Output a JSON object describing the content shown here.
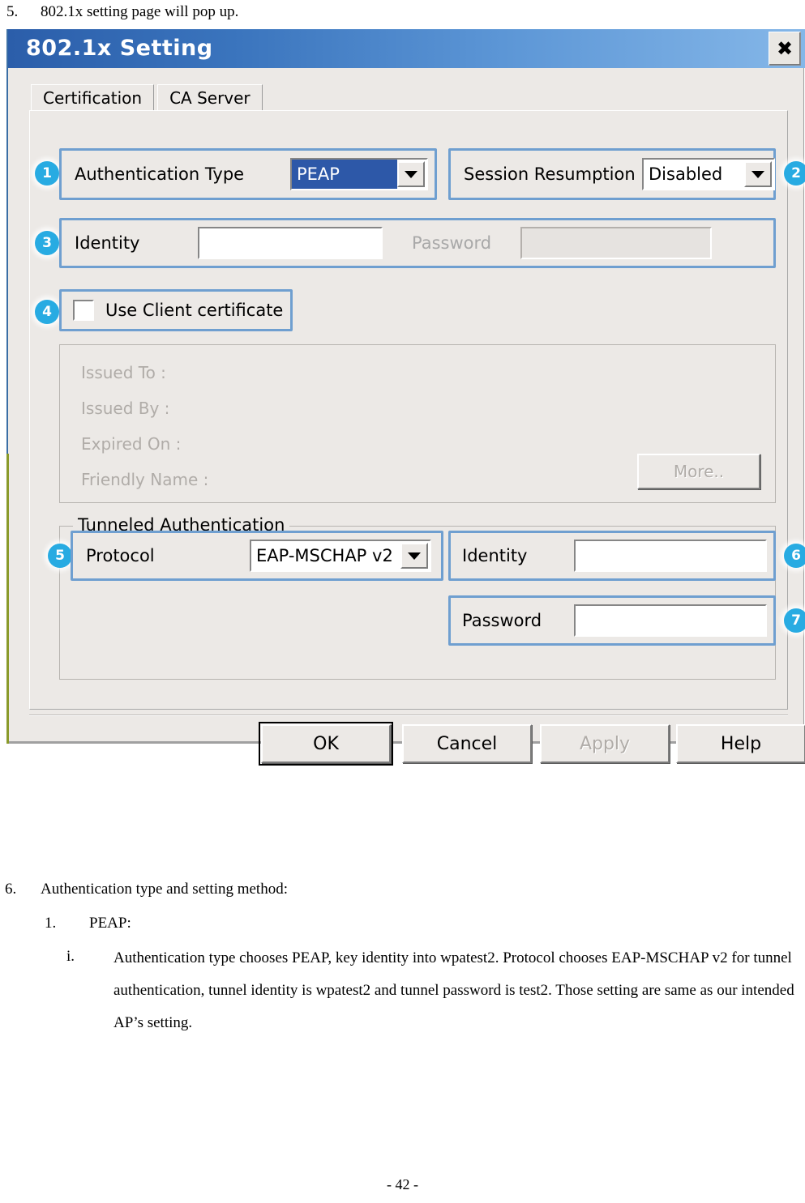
{
  "document": {
    "step5": {
      "number": "5.",
      "text": "802.1x setting page will pop up."
    },
    "step6": {
      "number": "6.",
      "text": "Authentication type and setting method:"
    },
    "sub1": {
      "number": "1.",
      "text": "PEAP:"
    },
    "subi": {
      "number": "i.",
      "text": "Authentication type chooses PEAP, key identity into wpatest2. Protocol chooses EAP-MSCHAP v2 for tunnel authentication, tunnel identity is wpatest2 and tunnel password is test2. Those setting are same as our intended AP’s setting."
    },
    "footer": "- 42 -"
  },
  "dialog": {
    "title": "802.1x Setting",
    "close_label": "✖",
    "tabs": [
      {
        "label": "Certification",
        "active": true
      },
      {
        "label": "CA Server",
        "active": false
      }
    ],
    "auth_type": {
      "label": "Authentication Type",
      "value": "PEAP",
      "badge": "1"
    },
    "session_resumption": {
      "label": "Session Resumption",
      "value": "Disabled",
      "badge": "2"
    },
    "credentials": {
      "identity_label": "Identity",
      "identity_value": "",
      "password_label": "Password",
      "password_value": "",
      "badge": "3"
    },
    "use_client_certificate": {
      "label": "Use Client certificate",
      "checked": false,
      "badge": "4"
    },
    "certificate_info": {
      "lines": [
        "Issued To :",
        "Issued By :",
        "Expired On :",
        "Friendly Name :"
      ],
      "more_button": "More.."
    },
    "tunneled_authentication": {
      "group_title": "Tunneled Authentication",
      "protocol_label": "Protocol",
      "protocol_value": "EAP-MSCHAP v2",
      "protocol_badge": "5",
      "identity_label": "Identity",
      "identity_value": "",
      "identity_badge": "6",
      "password_label": "Password",
      "password_value": "",
      "password_badge": "7"
    },
    "buttons": {
      "ok": "OK",
      "cancel": "Cancel",
      "apply": "Apply",
      "help": "Help"
    }
  },
  "colors": {
    "titlebar_start": "#2b5eaa",
    "titlebar_end": "#85b7e8",
    "badge": "#28abe2",
    "highlight_outline": "#6f9fd0",
    "selection_blue": "#2d58a8",
    "dialog_face": "#ece9e6"
  }
}
